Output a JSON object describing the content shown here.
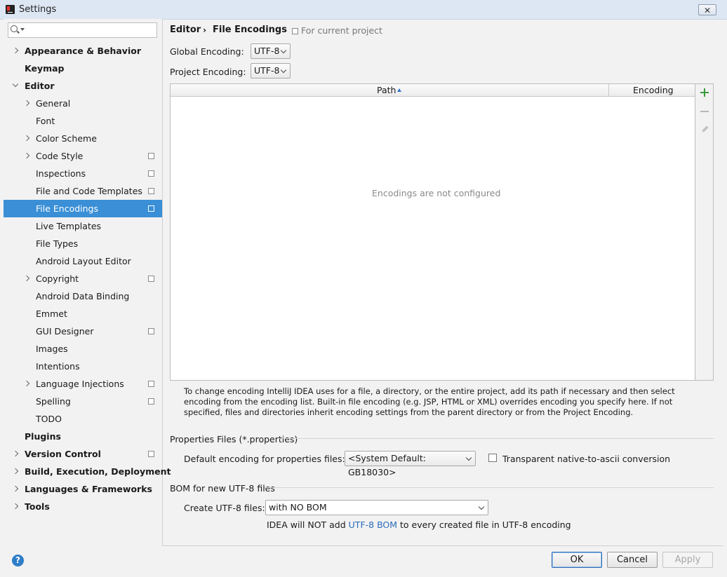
{
  "window": {
    "title": "Settings",
    "close_label": "✕"
  },
  "search": {
    "placeholder": ""
  },
  "sidebar": {
    "items": [
      {
        "label": "Appearance & Behavior",
        "bold": true,
        "expander": "right",
        "indent": 0,
        "shared": false
      },
      {
        "label": "Keymap",
        "bold": true,
        "expander": "",
        "indent": 0,
        "shared": false
      },
      {
        "label": "Editor",
        "bold": true,
        "expander": "down",
        "indent": 0,
        "shared": false
      },
      {
        "label": "General",
        "bold": false,
        "expander": "right",
        "indent": 1,
        "shared": false
      },
      {
        "label": "Font",
        "bold": false,
        "expander": "",
        "indent": 1,
        "shared": false
      },
      {
        "label": "Color Scheme",
        "bold": false,
        "expander": "right",
        "indent": 1,
        "shared": false
      },
      {
        "label": "Code Style",
        "bold": false,
        "expander": "right",
        "indent": 1,
        "shared": true
      },
      {
        "label": "Inspections",
        "bold": false,
        "expander": "",
        "indent": 1,
        "shared": true
      },
      {
        "label": "File and Code Templates",
        "bold": false,
        "expander": "",
        "indent": 1,
        "shared": true
      },
      {
        "label": "File Encodings",
        "bold": false,
        "expander": "",
        "indent": 1,
        "shared": true,
        "selected": true
      },
      {
        "label": "Live Templates",
        "bold": false,
        "expander": "",
        "indent": 1,
        "shared": false
      },
      {
        "label": "File Types",
        "bold": false,
        "expander": "",
        "indent": 1,
        "shared": false
      },
      {
        "label": "Android Layout Editor",
        "bold": false,
        "expander": "",
        "indent": 1,
        "shared": false
      },
      {
        "label": "Copyright",
        "bold": false,
        "expander": "right",
        "indent": 1,
        "shared": true
      },
      {
        "label": "Android Data Binding",
        "bold": false,
        "expander": "",
        "indent": 1,
        "shared": false
      },
      {
        "label": "Emmet",
        "bold": false,
        "expander": "",
        "indent": 1,
        "shared": false
      },
      {
        "label": "GUI Designer",
        "bold": false,
        "expander": "",
        "indent": 1,
        "shared": true
      },
      {
        "label": "Images",
        "bold": false,
        "expander": "",
        "indent": 1,
        "shared": false
      },
      {
        "label": "Intentions",
        "bold": false,
        "expander": "",
        "indent": 1,
        "shared": false
      },
      {
        "label": "Language Injections",
        "bold": false,
        "expander": "right",
        "indent": 1,
        "shared": true
      },
      {
        "label": "Spelling",
        "bold": false,
        "expander": "",
        "indent": 1,
        "shared": true
      },
      {
        "label": "TODO",
        "bold": false,
        "expander": "",
        "indent": 1,
        "shared": false
      },
      {
        "label": "Plugins",
        "bold": true,
        "expander": "",
        "indent": 0,
        "shared": false
      },
      {
        "label": "Version Control",
        "bold": true,
        "expander": "right",
        "indent": 0,
        "shared": true
      },
      {
        "label": "Build, Execution, Deployment",
        "bold": true,
        "expander": "right",
        "indent": 0,
        "shared": false
      },
      {
        "label": "Languages & Frameworks",
        "bold": true,
        "expander": "right",
        "indent": 0,
        "shared": false
      },
      {
        "label": "Tools",
        "bold": true,
        "expander": "right",
        "indent": 0,
        "shared": false
      }
    ]
  },
  "breadcrumb": {
    "parent": "Editor",
    "separator": "›",
    "current": "File Encodings",
    "scope": "For current project"
  },
  "encoding": {
    "global_label": "Global Encoding:",
    "global_value": "UTF-8",
    "project_label": "Project Encoding:",
    "project_value": "UTF-8"
  },
  "table": {
    "col_path": "Path",
    "col_encoding": "Encoding",
    "empty_text": "Encodings are not configured"
  },
  "help_text": "To change encoding IntelliJ IDEA uses for a file, a directory, or the entire project, add its path if necessary and then select encoding from the encoding list. Built-in file encoding (e.g. JSP, HTML or XML) overrides encoding you specify here. If not specified, files and directories inherit encoding settings from the parent directory or from the Project Encoding.",
  "properties": {
    "section_title": "Properties Files (*.properties)",
    "default_label": "Default encoding for properties files:",
    "default_value": "<System Default: GB18030>",
    "transparent_label": "Transparent native-to-ascii conversion",
    "transparent_checked": false
  },
  "bom": {
    "section_title": "BOM for new UTF-8 files",
    "create_label": "Create UTF-8 files:",
    "create_value": "with NO BOM",
    "note_prefix": "IDEA will NOT add ",
    "note_link": "UTF-8 BOM",
    "note_suffix": " to every created file in UTF-8 encoding"
  },
  "buttons": {
    "help": "?",
    "ok": "OK",
    "cancel": "Cancel",
    "apply": "Apply"
  },
  "colors": {
    "selection": "#3a8fd6",
    "add_green": "#3d9a3d",
    "link_blue": "#2b6cb8"
  },
  "icons": {
    "search": "search-icon",
    "add": "plus-icon",
    "remove": "minus-icon",
    "edit": "pencil-icon",
    "shared": "project-scope-icon"
  }
}
